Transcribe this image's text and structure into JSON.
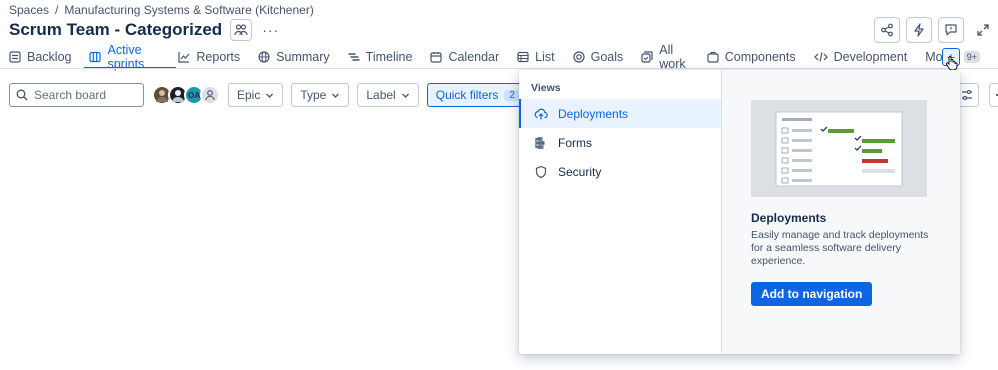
{
  "breadcrumb": {
    "spaces": "Spaces",
    "separator": "/",
    "project": "Manufacturing Systems & Software (Kitchener)"
  },
  "header": {
    "title": "Scrum Team - Categorized",
    "more": "···"
  },
  "tabs": [
    {
      "label": "Backlog",
      "icon": "backlog-icon"
    },
    {
      "label": "Active sprints",
      "icon": "board-icon",
      "active": true
    },
    {
      "label": "Reports",
      "icon": "reports-icon"
    },
    {
      "label": "Summary",
      "icon": "globe-icon"
    },
    {
      "label": "Timeline",
      "icon": "timeline-icon"
    },
    {
      "label": "Calendar",
      "icon": "calendar-icon"
    },
    {
      "label": "List",
      "icon": "list-icon"
    },
    {
      "label": "Goals",
      "icon": "goals-icon"
    },
    {
      "label": "All work",
      "icon": "all-work-icon"
    },
    {
      "label": "Components",
      "icon": "components-icon"
    },
    {
      "label": "Development",
      "icon": "code-icon"
    },
    {
      "label": "More",
      "badge": "9+"
    }
  ],
  "plus": "+",
  "filters": {
    "search_placeholder": "Search board",
    "avatar_initials": "OA",
    "epic": "Epic",
    "type": "Type",
    "label": "Label",
    "quick_filters": "Quick filters",
    "quick_filters_count": "2"
  },
  "popup": {
    "section_label": "Views",
    "items": [
      {
        "label": "Deployments",
        "icon": "deployments-icon",
        "selected": true
      },
      {
        "label": "Forms",
        "icon": "forms-icon"
      },
      {
        "label": "Security",
        "icon": "shield-icon"
      }
    ],
    "heading": "Deployments",
    "description": "Easily manage and track deployments for a seamless software delivery experience.",
    "button": "Add to navigation"
  },
  "colors": {
    "accent": "#0c66e4",
    "selected_bg": "#e9f2ff",
    "text": "#172b4d",
    "muted": "#44546f"
  }
}
